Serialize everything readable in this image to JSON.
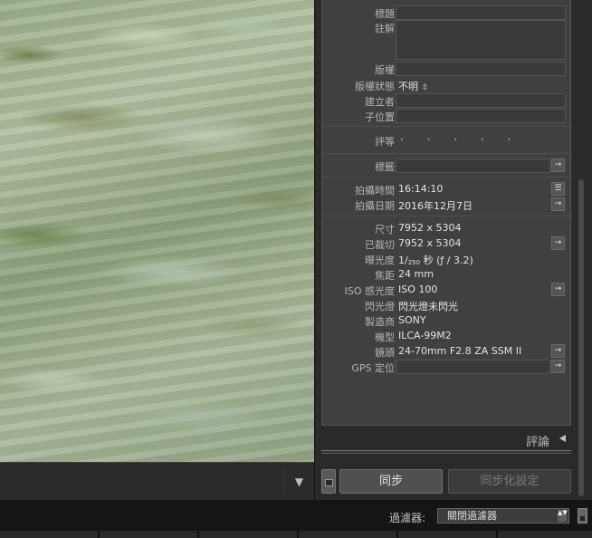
{
  "photo": {
    "collapse_icon": "▼"
  },
  "metadata": {
    "title": {
      "label": "標題"
    },
    "caption": {
      "label": "註解"
    },
    "copyright": {
      "label": "版權"
    },
    "copyright_status": {
      "label": "版權狀態",
      "value": "不明",
      "icon": "⇕"
    },
    "creator": {
      "label": "建立者"
    },
    "sublocation": {
      "label": "子位置"
    },
    "rating": {
      "label": "評等",
      "stars": "· · · · ·"
    },
    "label": {
      "label": "標籤",
      "button": "→"
    },
    "capture_time": {
      "label": "拍攝時間",
      "value": "16:14:10",
      "button": "☰"
    },
    "capture_date": {
      "label": "拍攝日期",
      "value": "2016年12月7日",
      "button": "→"
    },
    "dimensions": {
      "label": "尺寸",
      "value": "7952 x 5304"
    },
    "cropped": {
      "label": "已裁切",
      "value": "7952 x 5304",
      "button": "→"
    },
    "exposure": {
      "label": "曝光度",
      "value_prefix": "1/",
      "value_sub": "250",
      "value_suffix": " 秒 (ƒ / 3.2)"
    },
    "focal_length": {
      "label": "焦距",
      "value": "24 mm"
    },
    "iso": {
      "label": "ISO 感光度",
      "value": "ISO 100",
      "button": "→"
    },
    "flash": {
      "label": "閃光燈",
      "value": "閃光燈未閃光"
    },
    "make": {
      "label": "製造商",
      "value": "SONY"
    },
    "model": {
      "label": "機型",
      "value": "ILCA-99M2"
    },
    "lens": {
      "label": "鏡頭",
      "value": "24-70mm F2.8 ZA SSM II",
      "button": "→"
    },
    "gps": {
      "label": "GPS 定位",
      "button": "→"
    }
  },
  "comments": {
    "title": "評論"
  },
  "sync": {
    "sync_label": "同步",
    "sync_settings_label": "同步化設定"
  },
  "filter": {
    "label": "過濾器:",
    "value": "關閉過濾器",
    "icon": "▲▼"
  }
}
